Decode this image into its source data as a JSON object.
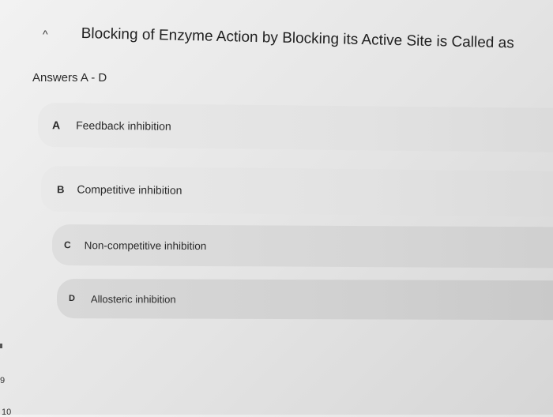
{
  "question": {
    "collapse_glyph": "^",
    "title": "Blocking of Enzyme Action by Blocking its Active Site is Called as"
  },
  "answers_label": "Answers A - D",
  "options": [
    {
      "letter": "A",
      "text": "Feedback inhibition"
    },
    {
      "letter": "B",
      "text": "Competitive inhibition"
    },
    {
      "letter": "C",
      "text": "Non-competitive inhibition"
    },
    {
      "letter": "D",
      "text": "Allosteric inhibition"
    }
  ],
  "side_numbers": [
    "9",
    "10"
  ]
}
